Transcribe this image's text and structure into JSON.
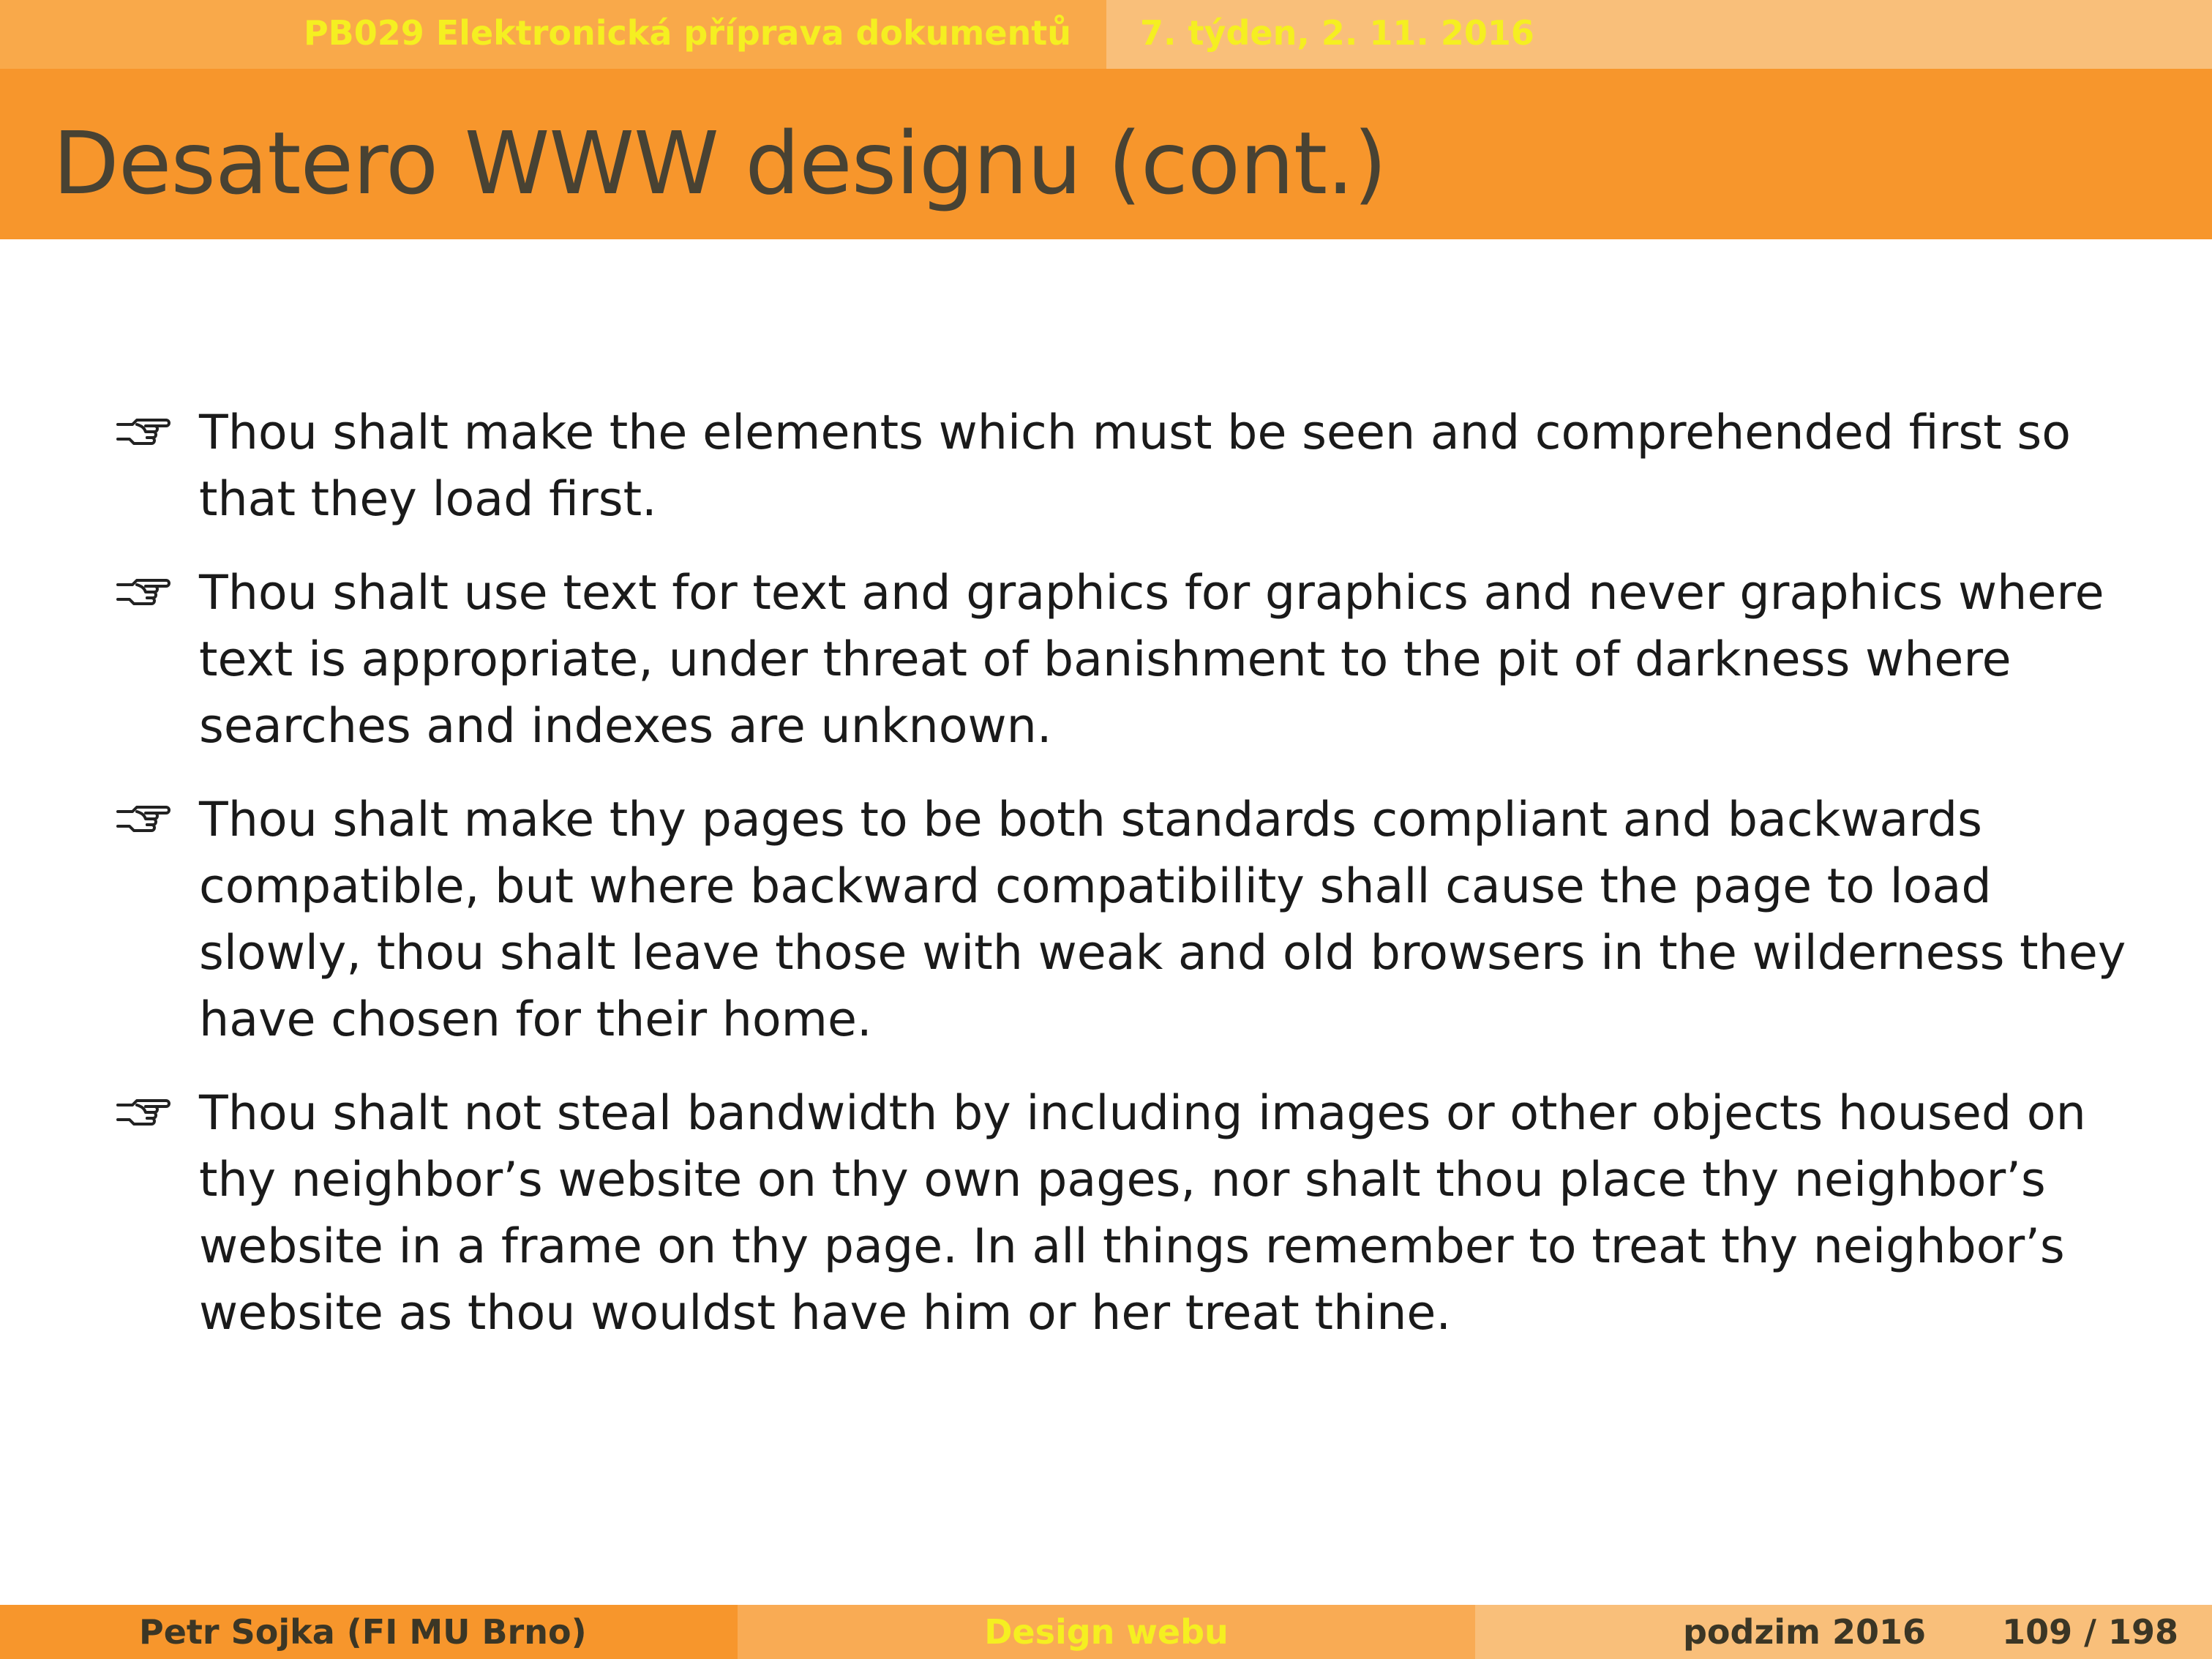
{
  "header": {
    "course": "PB029 Elektronická příprava dokumentů",
    "date": "7. týden, 2. 11. 2016"
  },
  "slide": {
    "title": "Desatero WWW designu (cont.)",
    "bullet_icon": "pointing-hand-icon",
    "items": [
      "Thou shalt make the elements which must be seen and comprehended first so that they load first.",
      "Thou shalt use text for text and graphics for graphics and never graphics where text is appropriate, under threat of banishment to the pit of darkness where searches and indexes are unknown.",
      "Thou shalt make thy pages to be both standards compliant and backwards compatible, but where backward compatibility shall cause the page to load slowly, thou shalt leave those with weak and old browsers in the wilderness they have chosen for their home.",
      "Thou shalt not steal bandwidth by including images or other objects housed on thy neighbor’s website on thy own pages, nor shalt thou place thy neighbor’s website in a frame on thy page. In all things remember to treat thy neighbor’s website as thou wouldst have him or her treat thine."
    ]
  },
  "footer": {
    "author": "Petr Sojka  (FI MU Brno)",
    "section": "Design webu",
    "term": "podzim 2016",
    "pages": "109 / 198"
  },
  "colors": {
    "title_bar": "#f7962c",
    "header_left": "#f9a94a",
    "header_right": "#f9bf7a",
    "header_text": "#f5ef21",
    "title_text": "#484233"
  }
}
